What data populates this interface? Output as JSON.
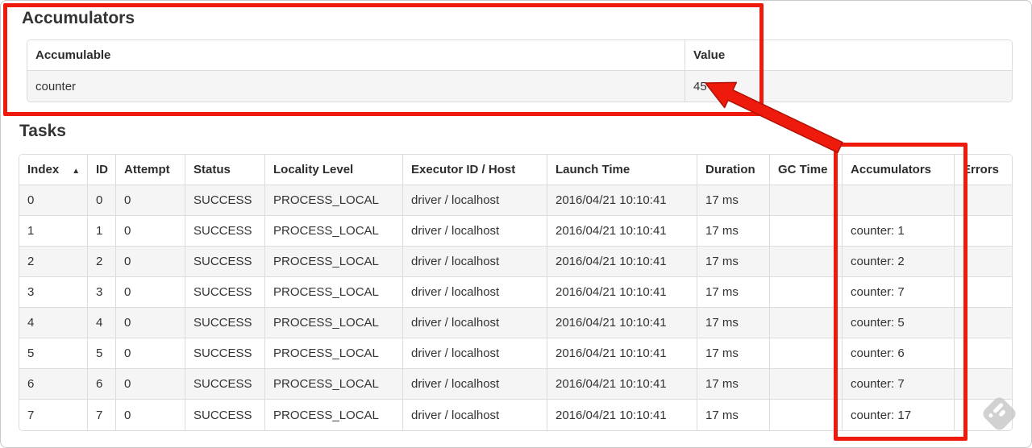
{
  "annotation": {
    "color": "#ee1a0b"
  },
  "watermark_icon": "skitch-style-stamp",
  "accumulators_section": {
    "heading": "Accumulators",
    "columns": [
      "Accumulable",
      "Value"
    ],
    "rows": [
      [
        "counter",
        "45"
      ]
    ]
  },
  "tasks_section": {
    "heading": "Tasks",
    "sort_icon": "▲",
    "columns": [
      "Index",
      "ID",
      "Attempt",
      "Status",
      "Locality Level",
      "Executor ID / Host",
      "Launch Time",
      "Duration",
      "GC Time",
      "Accumulators",
      "Errors"
    ],
    "rows": [
      [
        "0",
        "0",
        "0",
        "SUCCESS",
        "PROCESS_LOCAL",
        "driver / localhost",
        "2016/04/21 10:10:41",
        "17 ms",
        "",
        "",
        ""
      ],
      [
        "1",
        "1",
        "0",
        "SUCCESS",
        "PROCESS_LOCAL",
        "driver / localhost",
        "2016/04/21 10:10:41",
        "17 ms",
        "",
        "counter: 1",
        ""
      ],
      [
        "2",
        "2",
        "0",
        "SUCCESS",
        "PROCESS_LOCAL",
        "driver / localhost",
        "2016/04/21 10:10:41",
        "17 ms",
        "",
        "counter: 2",
        ""
      ],
      [
        "3",
        "3",
        "0",
        "SUCCESS",
        "PROCESS_LOCAL",
        "driver / localhost",
        "2016/04/21 10:10:41",
        "17 ms",
        "",
        "counter: 7",
        ""
      ],
      [
        "4",
        "4",
        "0",
        "SUCCESS",
        "PROCESS_LOCAL",
        "driver / localhost",
        "2016/04/21 10:10:41",
        "17 ms",
        "",
        "counter: 5",
        ""
      ],
      [
        "5",
        "5",
        "0",
        "SUCCESS",
        "PROCESS_LOCAL",
        "driver / localhost",
        "2016/04/21 10:10:41",
        "17 ms",
        "",
        "counter: 6",
        ""
      ],
      [
        "6",
        "6",
        "0",
        "SUCCESS",
        "PROCESS_LOCAL",
        "driver / localhost",
        "2016/04/21 10:10:41",
        "17 ms",
        "",
        "counter: 7",
        ""
      ],
      [
        "7",
        "7",
        "0",
        "SUCCESS",
        "PROCESS_LOCAL",
        "driver / localhost",
        "2016/04/21 10:10:41",
        "17 ms",
        "",
        "counter: 17",
        ""
      ]
    ]
  }
}
